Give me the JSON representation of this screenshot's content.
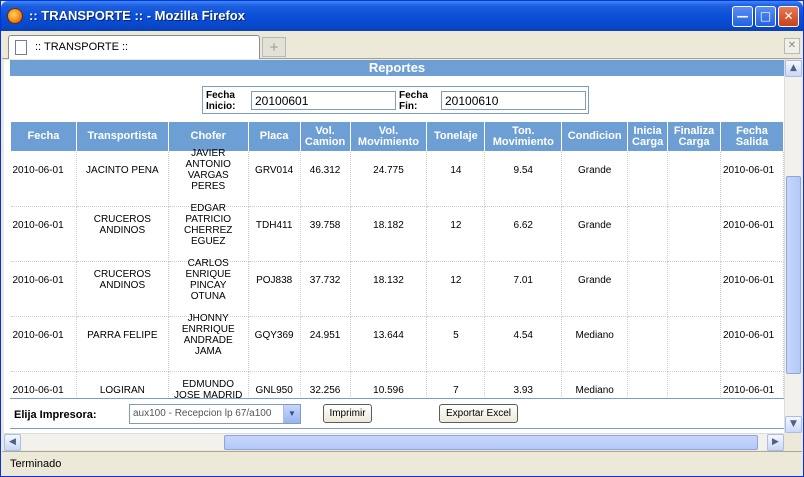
{
  "window": {
    "title": ":: TRANSPORTE :: - Mozilla Firefox"
  },
  "tab": {
    "label": ":: TRANSPORTE ::"
  },
  "page": {
    "heading": "Reportes"
  },
  "dates": {
    "inicio_label_1": "Fecha",
    "inicio_label_2": "Inicio:",
    "inicio_value": "20100601",
    "fin_label_1": "Fecha",
    "fin_label_2": "Fin:",
    "fin_value": "20100610"
  },
  "table": {
    "headers": [
      [
        "Fecha"
      ],
      [
        "Transportista"
      ],
      [
        "Chofer"
      ],
      [
        "Placa"
      ],
      [
        "Vol.",
        "Camion"
      ],
      [
        "Vol.",
        "Movimiento"
      ],
      [
        "Tonelaje"
      ],
      [
        "Ton.",
        "Movimiento"
      ],
      [
        "Condicion"
      ],
      [
        "Inicia",
        "Carga"
      ],
      [
        "Finaliza",
        "Carga"
      ],
      [
        "Fecha",
        "Salida"
      ]
    ],
    "rows": [
      {
        "fecha": "2010-06-01",
        "transportista": [
          "JACINTO PENA"
        ],
        "chofer": [
          "JAVIER",
          "ANTONIO",
          "VARGAS",
          "PERES"
        ],
        "placa": "GRV014",
        "vol_camion": "46.312",
        "vol_mov": "24.775",
        "tonelaje": "14",
        "ton_mov": "9.54",
        "condicion": "Grande",
        "inicia": "",
        "finaliza": "",
        "salida": "2010-06-01"
      },
      {
        "fecha": "2010-06-01",
        "transportista": [
          "CRUCEROS",
          "ANDINOS"
        ],
        "chofer": [
          "EDGAR",
          "PATRICIO",
          "CHERREZ",
          "EGUEZ"
        ],
        "placa": "TDH411",
        "vol_camion": "39.758",
        "vol_mov": "18.182",
        "tonelaje": "12",
        "ton_mov": "6.62",
        "condicion": "Grande",
        "inicia": "",
        "finaliza": "",
        "salida": "2010-06-01"
      },
      {
        "fecha": "2010-06-01",
        "transportista": [
          "CRUCEROS",
          "ANDINOS"
        ],
        "chofer": [
          "CARLOS",
          "ENRIQUE",
          "PINCAY",
          "OTUNA"
        ],
        "placa": "POJ838",
        "vol_camion": "37.732",
        "vol_mov": "18.132",
        "tonelaje": "12",
        "ton_mov": "7.01",
        "condicion": "Grande",
        "inicia": "",
        "finaliza": "",
        "salida": "2010-06-01"
      },
      {
        "fecha": "2010-06-01",
        "transportista": [
          "PARRA FELIPE"
        ],
        "chofer": [
          "JHONNY",
          "ENRRIQUE",
          "ANDRADE",
          "JAMA"
        ],
        "placa": "GQY369",
        "vol_camion": "24.951",
        "vol_mov": "13.644",
        "tonelaje": "5",
        "ton_mov": "4.54",
        "condicion": "Mediano",
        "inicia": "",
        "finaliza": "",
        "salida": "2010-06-01"
      },
      {
        "fecha": "2010-06-01",
        "transportista": [
          "LOGIRAN",
          ""
        ],
        "chofer": [
          "EDMUNDO",
          "JOSE MADRID",
          "",
          ""
        ],
        "placa": "GNL950",
        "vol_camion": "32.256",
        "vol_mov": "10.596",
        "tonelaje": "7",
        "ton_mov": "3.93",
        "condicion": "Mediano",
        "inicia": "",
        "finaliza": "",
        "salida": "2010-06-01"
      }
    ]
  },
  "controls": {
    "printer_label": "Elija Impresora:",
    "printer_selected": "aux100 - Recepcion lp 67/a100",
    "print_button": "Imprimir",
    "export_button": "Exportar Excel"
  },
  "status": {
    "text": "Terminado"
  }
}
